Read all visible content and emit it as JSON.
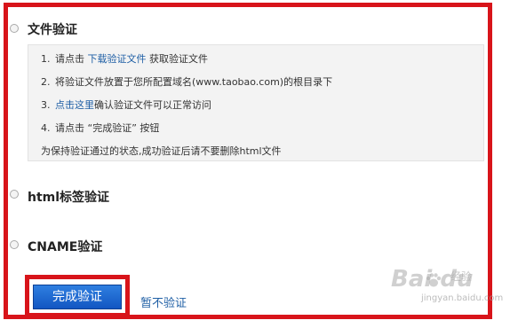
{
  "options": [
    {
      "label": "文件验证"
    },
    {
      "label": "html标签验证"
    },
    {
      "label": "CNAME验证"
    }
  ],
  "steps": {
    "s1": {
      "num": "1.",
      "pre": "请点击 ",
      "link": "下载验证文件",
      "post": " 获取验证文件"
    },
    "s2": {
      "num": "2.",
      "text": "将验证文件放置于您所配置域名(www.taobao.com)的根目录下"
    },
    "s3": {
      "num": "3.",
      "link": "点击这里",
      "post": "确认验证文件可以正常访问"
    },
    "s4": {
      "num": "4.",
      "text": "请点击 “完成验证” 按钮"
    },
    "note": "为保持验证通过的状态,成功验证后请不要删除html文件"
  },
  "actions": {
    "complete": "完成验证",
    "skip": "暂不验证"
  },
  "watermark": {
    "logo": "Bai du",
    "sub": "经验",
    "url": "jingyan.baidu.com"
  },
  "colors": {
    "highlight_border": "#d8141a",
    "link": "#1f5fa5",
    "primary_button": "#1a63cf"
  }
}
